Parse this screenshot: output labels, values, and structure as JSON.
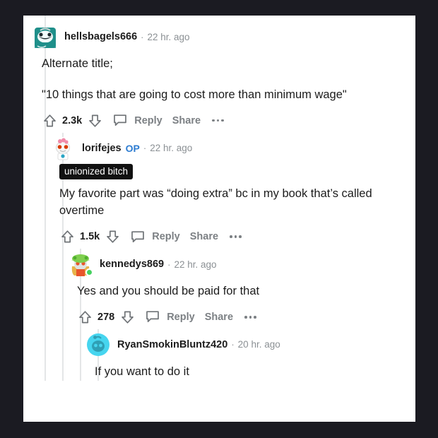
{
  "theme": {
    "page_background": "#1b1b22",
    "card_background": "#ffffff",
    "text_color": "#1c1c1c",
    "muted_color": "#8b9094",
    "action_color": "#7c8084",
    "op_badge_color": "#2d7cd1",
    "thread_line_color": "#e4e6e7",
    "online_dot_color": "#46d160",
    "flair_background": "#111111",
    "flair_text_color": "#ffffff"
  },
  "separator": "·",
  "actions": {
    "upvote_icon": "upvote-arrow-icon",
    "downvote_icon": "downvote-arrow-icon",
    "comment_icon": "comment-bubble-icon",
    "reply_label": "Reply",
    "share_label": "Share",
    "overflow_label": "more-options-icon"
  },
  "comments": [
    {
      "username": "hellsbagels666",
      "is_op": false,
      "op_label": "",
      "timeago": "22 hr. ago",
      "flair": "",
      "online": false,
      "avatar_name": "avatar-hellsbagels666",
      "avatar_colors": {
        "base": "#1f8f8a",
        "accent": "#ffffff",
        "dark": "#1d2a2e"
      },
      "paragraphs": [
        "Alternate title;",
        "\"10 things that are going to cost more than minimum wage\""
      ],
      "score": "2.3k",
      "depth": 0
    },
    {
      "username": "lorifejes",
      "is_op": true,
      "op_label": "OP",
      "timeago": "22 hr. ago",
      "flair": "unionized bitch",
      "online": false,
      "avatar_name": "avatar-lorifejes",
      "avatar_colors": {
        "base": "#ffffff",
        "accent": "#f08aa8",
        "dark": "#d93a00"
      },
      "paragraphs": [
        "My favorite part was “doing extra” bc in my book that’s called overtime"
      ],
      "score": "1.5k",
      "depth": 1
    },
    {
      "username": "kennedys869",
      "is_op": false,
      "op_label": "",
      "timeago": "22 hr. ago",
      "flair": "",
      "online": true,
      "avatar_name": "avatar-kennedys869",
      "avatar_colors": {
        "base": "#7fcf4f",
        "accent": "#e8b34a",
        "dark": "#e8552b"
      },
      "paragraphs": [
        "Yes and you should be paid for that"
      ],
      "score": "278",
      "depth": 2
    },
    {
      "username": "RyanSmokinBluntz420",
      "is_op": false,
      "op_label": "",
      "timeago": "20 hr. ago",
      "flair": "",
      "online": false,
      "avatar_name": "avatar-ryansmokinbluntz420",
      "avatar_colors": {
        "base": "#46d5ef",
        "accent": "#2f9fb5",
        "dark": "#2f9fb5"
      },
      "paragraphs": [
        "If you want to do it"
      ],
      "score": "",
      "depth": 3
    }
  ]
}
